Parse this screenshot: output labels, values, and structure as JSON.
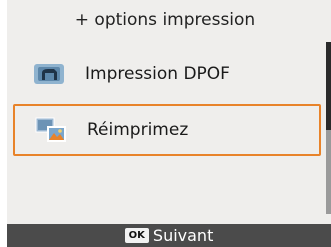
{
  "header": {
    "title": "+ options impression"
  },
  "menu": {
    "items": [
      {
        "label": "Impression DPOF",
        "icon": "dpof-print-icon",
        "selected": false
      },
      {
        "label": "Réimprimez",
        "icon": "reprint-photos-icon",
        "selected": true
      }
    ]
  },
  "footer": {
    "button_badge": "OK",
    "button_label": "Suivant"
  },
  "colors": {
    "selection": "#e8832a",
    "background": "#efeeec",
    "footer": "#4b4b4b"
  }
}
